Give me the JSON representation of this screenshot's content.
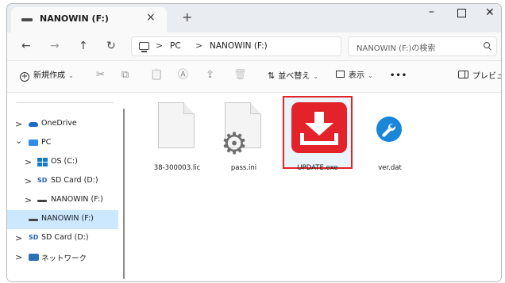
{
  "window": {
    "tab_title": "NANOWIN (F:)",
    "tab_close": "×",
    "new_tab": "+",
    "minimize": "–",
    "close": "✕"
  },
  "nav": {
    "back": "←",
    "forward": "→",
    "up": "↑",
    "refresh": "↻",
    "breadcrumb_sep": ">",
    "breadcrumb": [
      "PC",
      "NANOWIN (F:)"
    ],
    "search_placeholder": "NANOWIN (F:)の検索"
  },
  "toolbar": {
    "new_label": "新規作成",
    "cut": "✂",
    "copy": "⧉",
    "paste": "📋",
    "rename": "Ⓐ",
    "share": "⇪",
    "delete": "🗑",
    "sort_label": "並べ替え",
    "view_label": "表示",
    "more": "•••",
    "preview_label": "プレビュー"
  },
  "sidebar": {
    "items": [
      {
        "label": "OneDrive",
        "chevron": ">"
      },
      {
        "label": "PC",
        "chevron": "⌄"
      },
      {
        "label": "OS (C:)",
        "chevron": ">"
      },
      {
        "label": "SD Card (D:)",
        "chevron": ">"
      },
      {
        "label": "NANOWIN (F:)",
        "chevron": ">"
      },
      {
        "label": "NANOWIN (F:)",
        "chevron": ""
      },
      {
        "label": "SD Card (D:)",
        "chevron": ">"
      },
      {
        "label": "ネットワーク",
        "chevron": ">"
      }
    ],
    "sd_badge": "SD"
  },
  "files": [
    {
      "name": "38-300003.lic",
      "icon": "document-icon"
    },
    {
      "name": "pass.ini",
      "icon": "settings-file-icon"
    },
    {
      "name": "UPDATE.exe",
      "icon": "download-icon",
      "selected": true,
      "highlight_color": "#e32329"
    },
    {
      "name": "ver.dat",
      "icon": "wrench-icon"
    }
  ],
  "colors": {
    "accent": "#e32329",
    "selection": "#cce8ff",
    "blue_icon": "#1a86d8"
  }
}
